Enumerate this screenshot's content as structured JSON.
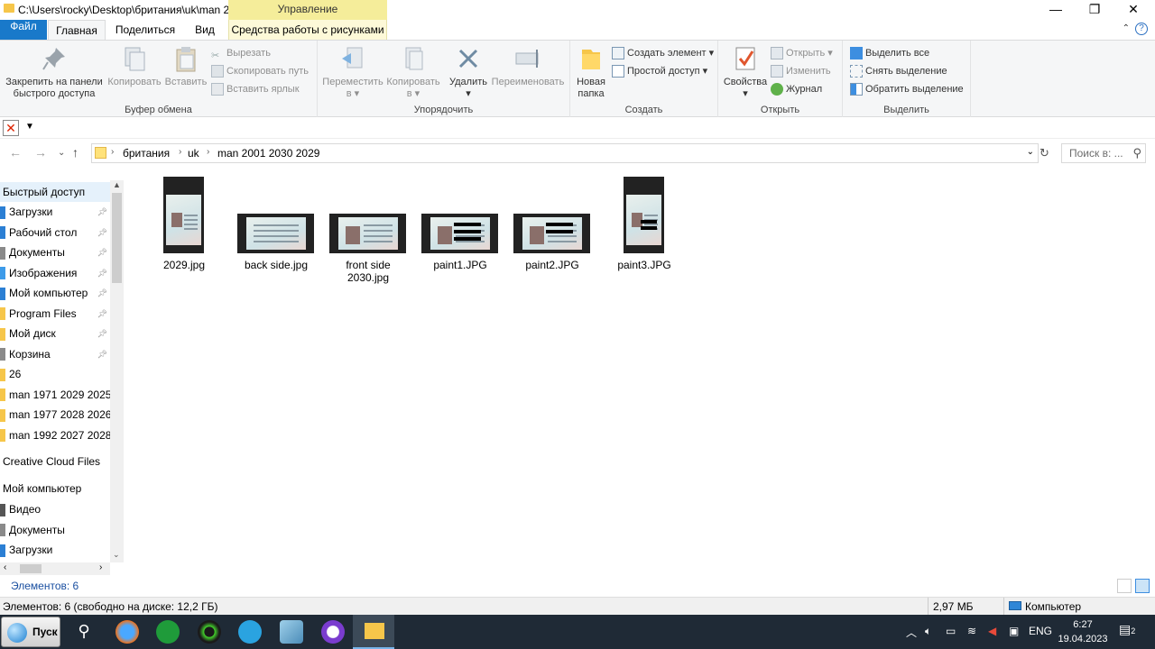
{
  "window": {
    "path": "C:\\Users\\rocky\\Desktop\\британия\\uk\\man 2...",
    "manage_tab": "Управление",
    "controls": {
      "minimize": "—",
      "maximize": "❐",
      "close": "✕"
    }
  },
  "tabs": {
    "file": "Файл",
    "home": "Главная",
    "share": "Поделиться",
    "view": "Вид",
    "picture_tools": "Средства работы с рисунками"
  },
  "ribbon": {
    "clipboard": {
      "label": "Буфер обмена",
      "pin": "Закрепить на панели быстрого доступа",
      "copy": "Копировать",
      "paste": "Вставить",
      "cut": "Вырезать",
      "copy_path": "Скопировать путь",
      "paste_shortcut": "Вставить ярлык"
    },
    "organize": {
      "label": "Упорядочить",
      "move_to": "Переместить в",
      "copy_to": "Копировать в",
      "delete": "Удалить",
      "rename": "Переименовать"
    },
    "create": {
      "label": "Создать",
      "new_folder": "Новая папка",
      "new_item": "Создать элемент",
      "easy_access": "Простой доступ"
    },
    "open": {
      "label": "Открыть",
      "properties": "Свойства",
      "open": "Открыть",
      "edit": "Изменить",
      "history": "Журнал"
    },
    "select": {
      "label": "Выделить",
      "select_all": "Выделить все",
      "select_none": "Снять выделение",
      "invert": "Обратить выделение"
    }
  },
  "address": {
    "crumbs": [
      "британия",
      "uk",
      "man 2001 2030 2029"
    ],
    "search_placeholder": "Поиск в: ..."
  },
  "nav": {
    "quick_access": "Быстрый доступ",
    "items": [
      {
        "label": "Загрузки",
        "pinned": true,
        "color": "#2b7fd4"
      },
      {
        "label": "Рабочий стол",
        "pinned": true,
        "color": "#2b7fd4"
      },
      {
        "label": "Документы",
        "pinned": true,
        "color": "#8a8a8a"
      },
      {
        "label": "Изображения",
        "pinned": true,
        "color": "#3d9be9"
      },
      {
        "label": "Мой компьютер",
        "pinned": true,
        "color": "#2b7fd4"
      },
      {
        "label": "Program Files",
        "pinned": true,
        "color": "#f6c64a"
      },
      {
        "label": "Мой диск",
        "pinned": true,
        "color": "#f6c64a"
      },
      {
        "label": "Корзина",
        "pinned": true,
        "color": "#8a8a8a"
      },
      {
        "label": "26",
        "pinned": false,
        "color": "#f6c64a"
      },
      {
        "label": "man 1971 2029 2025",
        "pinned": false,
        "color": "#f6c64a"
      },
      {
        "label": "man 1977 2028 2026",
        "pinned": false,
        "color": "#f6c64a"
      },
      {
        "label": "man 1992 2027 2028",
        "pinned": false,
        "color": "#f6c64a"
      }
    ],
    "creative_cloud": "Creative Cloud Files",
    "my_computer": "Мой компьютер",
    "computer_items": [
      {
        "label": "Видео",
        "color": "#555555"
      },
      {
        "label": "Документы",
        "color": "#8a8a8a"
      },
      {
        "label": "Загрузки",
        "color": "#2b7fd4"
      }
    ]
  },
  "files": [
    {
      "name": "2029.jpg",
      "kind": "portrait"
    },
    {
      "name": "back side.jpg",
      "kind": "card"
    },
    {
      "name": "front side 2030.jpg",
      "kind": "card-front"
    },
    {
      "name": "paint1.JPG",
      "kind": "card-redacted"
    },
    {
      "name": "paint2.JPG",
      "kind": "card-redacted2"
    },
    {
      "name": "paint3.JPG",
      "kind": "portrait2"
    }
  ],
  "status": {
    "count": "Элементов: 6",
    "details_left": "Элементов: 6 (свободно на диске: 12,2 ГБ)",
    "size": "2,97 МБ",
    "location": "Компьютер"
  },
  "taskbar": {
    "start": "Пуск",
    "lang": "ENG",
    "time": "6:27",
    "date": "19.04.2023",
    "notifications": "2"
  }
}
